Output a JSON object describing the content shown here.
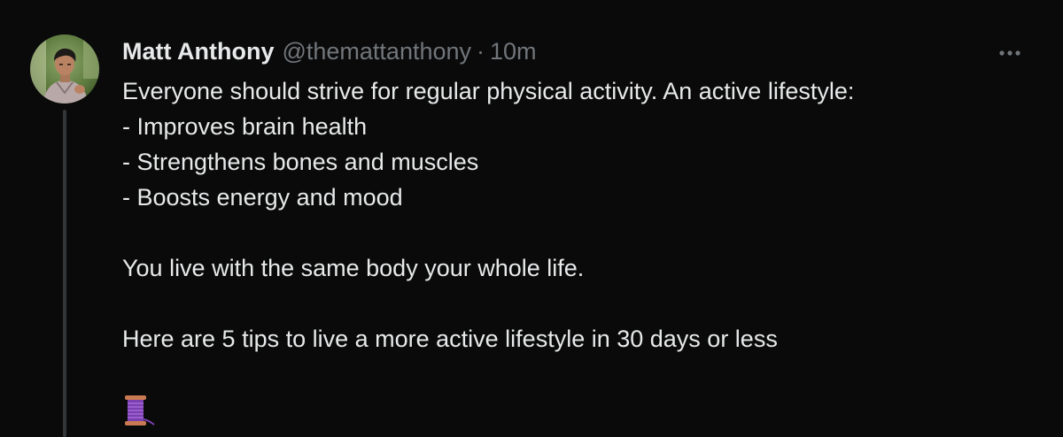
{
  "tweet": {
    "author_name": "Matt Anthony",
    "handle": "@themattanthony",
    "separator": "·",
    "time": "10m",
    "lines": [
      "Everyone should strive for regular physical activity. An active lifestyle:",
      "- Improves brain health",
      "- Strengthens bones and muscles",
      "- Boosts energy and mood"
    ],
    "paragraph_2": "You live with the same body your whole life.",
    "paragraph_3": "Here are 5 tips to live a more active lifestyle in 30 days or less",
    "emoji": "thread-spool-emoji"
  },
  "icons": {
    "more": "more-options-icon",
    "avatar": "profile-photo"
  },
  "colors": {
    "background": "#0a0a0a",
    "primary_text": "#e7e9ea",
    "secondary_text": "#71767b",
    "thread_line": "#333639"
  }
}
